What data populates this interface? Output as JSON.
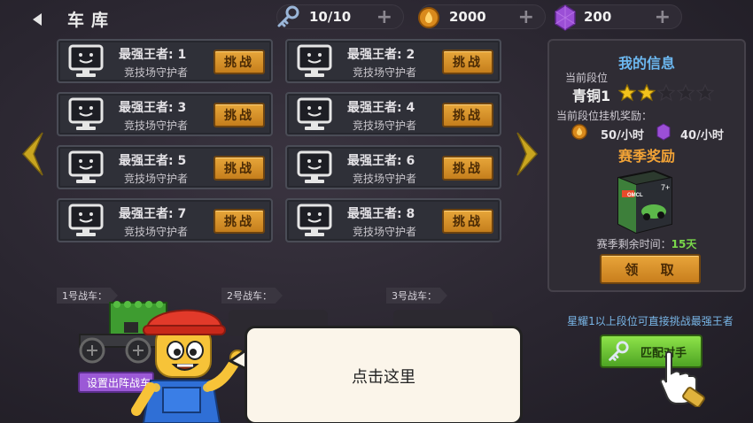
{
  "header": {
    "title": "车库",
    "resources": [
      {
        "icon": "key-icon",
        "value": "10/10"
      },
      {
        "icon": "fuel-coin-icon",
        "value": "2000"
      },
      {
        "icon": "purple-gem-icon",
        "value": "200"
      }
    ]
  },
  "opponents": [
    {
      "name": "最强王者: 1",
      "subtitle": "竞技场守护者",
      "button": "挑战"
    },
    {
      "name": "最强王者: 2",
      "subtitle": "竞技场守护者",
      "button": "挑战"
    },
    {
      "name": "最强王者: 3",
      "subtitle": "竞技场守护者",
      "button": "挑战"
    },
    {
      "name": "最强王者: 4",
      "subtitle": "竞技场守护者",
      "button": "挑战"
    },
    {
      "name": "最强王者: 5",
      "subtitle": "竞技场守护者",
      "button": "挑战"
    },
    {
      "name": "最强王者: 6",
      "subtitle": "竞技场守护者",
      "button": "挑战"
    },
    {
      "name": "最强王者: 7",
      "subtitle": "竞技场守护者",
      "button": "挑战"
    },
    {
      "name": "最强王者: 8",
      "subtitle": "竞技场守护者",
      "button": "挑战"
    }
  ],
  "info": {
    "title": "我的信息",
    "rank_label": "当前段位",
    "rank_name": "青铜1",
    "stars_filled": 2,
    "stars_total": 5,
    "idle_reward_label": "当前段位挂机奖励：",
    "coin_rate": "50/小时",
    "gem_rate": "40/小时",
    "season_title": "赛季奖励",
    "crate_label": "OMCL",
    "crate_badge": "7+",
    "remaining_label": "赛季剩余时间：",
    "remaining_days": "15天",
    "claim_button": "领 取",
    "hint": "星耀1以上段位可直接挑战最强王者",
    "match_button": "匹配对手"
  },
  "garage": {
    "slots": [
      "1号战车：",
      "2号战车：",
      "3号战车："
    ],
    "set_button": "设置出阵战车"
  },
  "tutorial": {
    "bubble_text": "点击这里"
  },
  "colors": {
    "accent_gold": "#e7a63a",
    "accent_green": "#6fcf3a",
    "info_blue": "#6cb8f0",
    "season_orange": "#f2a336",
    "gem_purple": "#9b59d6"
  }
}
